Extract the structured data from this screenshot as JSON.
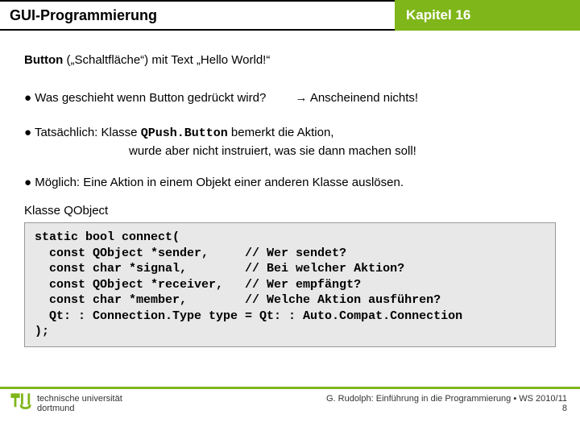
{
  "header": {
    "left": "GUI-Programmierung",
    "right": "Kapitel 16"
  },
  "body": {
    "line1_a": "Button",
    "line1_b": " („Schaltfläche“) mit Text „Hello World!“",
    "bullet1": "● Was geschieht wenn Button gedrückt wird?",
    "answer1": "→ Anscheinend nichts!",
    "bullet2_a": "● Tatsächlich:  Klasse ",
    "bullet2_code": "QPush.Button",
    "bullet2_b": "   bemerkt die Aktion,",
    "bullet2_c": "wurde aber nicht instruiert, was sie dann machen soll!",
    "bullet3": "● Möglich: Eine Aktion in einem Objekt einer anderen Klasse auslösen.",
    "klasse": "Klasse QObject",
    "code": "static bool connect(\n  const QObject *sender,     // Wer sendet?\n  const char *signal,        // Bei welcher Aktion?\n  const QObject *receiver,   // Wer empfängt?\n  const char *member,        // Welche Aktion ausführen?\n  Qt: : Connection.Type type = Qt: : Auto.Compat.Connection\n);"
  },
  "footer": {
    "uni1": "technische universität",
    "uni2": "dortmund",
    "credit": "G. Rudolph: Einführung in die Programmierung ▪ WS 2010/11",
    "page": "8"
  }
}
